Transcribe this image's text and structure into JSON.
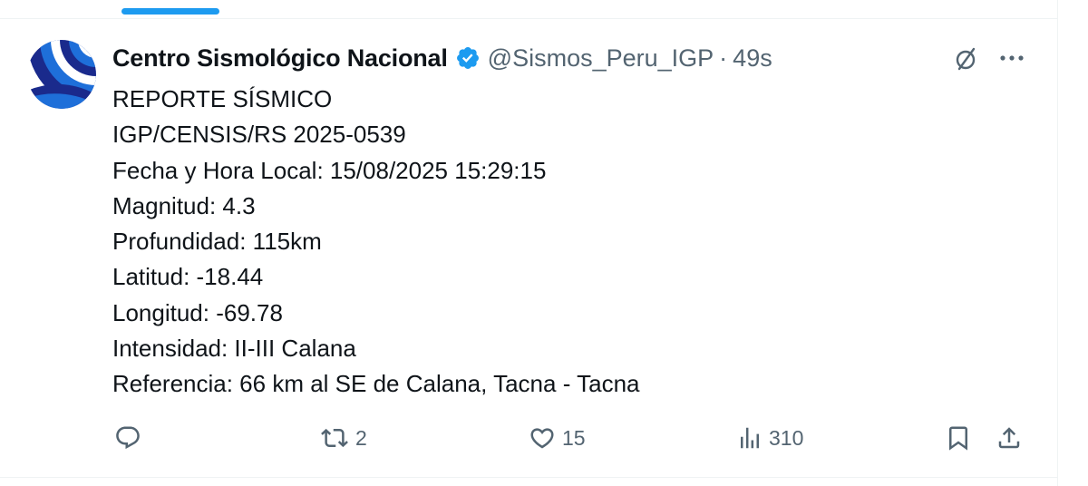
{
  "tweet": {
    "display_name": "Centro Sismológico Nacional",
    "handle": "@Sismos_Peru_IGP",
    "separator": "·",
    "time": "49s",
    "lines": [
      "REPORTE SÍSMICO",
      "IGP/CENSIS/RS 2025-0539",
      "Fecha y Hora Local: 15/08/2025 15:29:15",
      "Magnitud: 4.3",
      "Profundidad: 115km",
      "Latitud: -18.44",
      "Longitud: -69.78",
      "Intensidad: II-III Calana",
      "Referencia: 66 km al SE de Calana, Tacna - Tacna"
    ]
  },
  "actions": {
    "reply_count": "",
    "retweet_count": "2",
    "like_count": "15",
    "views_count": "310"
  },
  "icons": {
    "verified": "verified-badge-icon",
    "grok": "grok-icon",
    "more": "more-icon",
    "reply": "reply-icon",
    "retweet": "retweet-icon",
    "like": "heart-icon",
    "views": "views-icon",
    "bookmark": "bookmark-icon",
    "share": "share-icon"
  },
  "colors": {
    "accent": "#1d9bf0",
    "text": "#0f1419",
    "secondary": "#536471",
    "avatar_dark": "#1a2a8c"
  }
}
